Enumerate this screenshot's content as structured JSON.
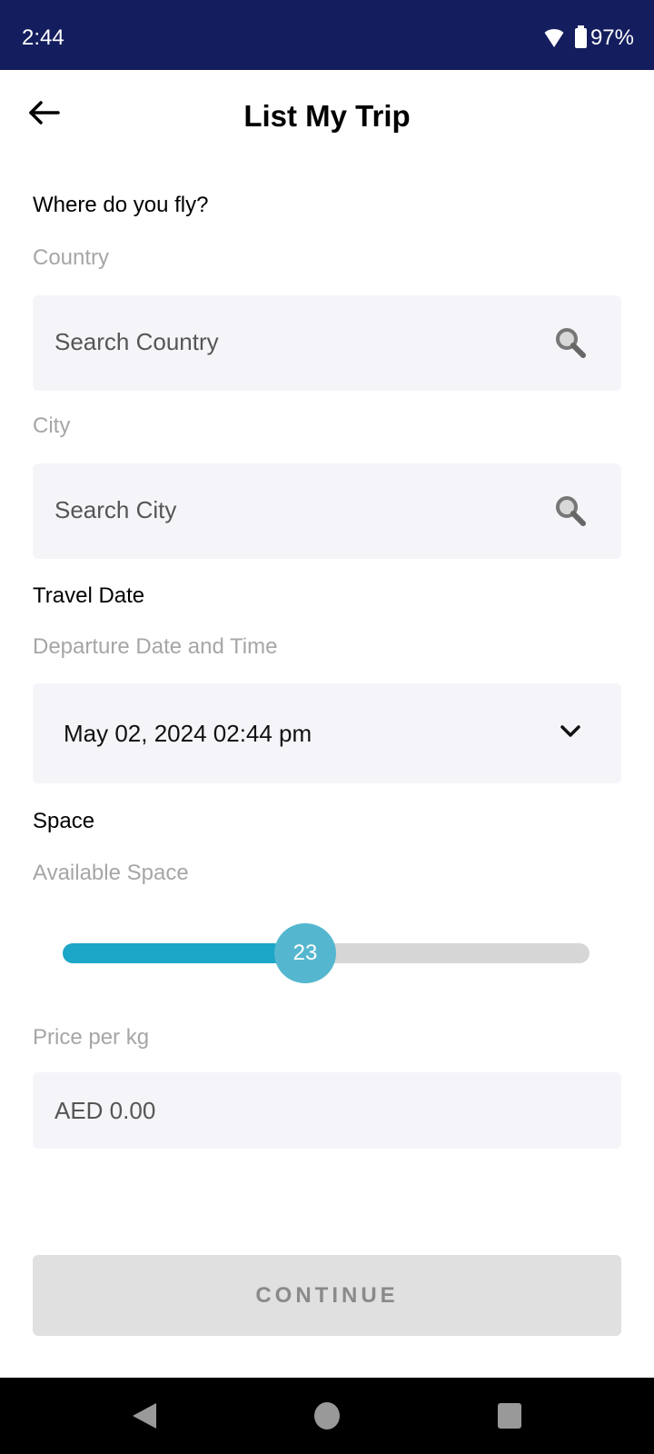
{
  "status_bar": {
    "time": "2:44",
    "battery": "97%"
  },
  "header": {
    "title": "List My Trip"
  },
  "location": {
    "section_title": "Where do you fly?",
    "country_label": "Country",
    "country_placeholder": "Search Country",
    "city_label": "City",
    "city_placeholder": "Search City"
  },
  "travel_date": {
    "section_title": "Travel Date",
    "label": "Departure Date and Time",
    "value": "May 02, 2024 02:44 pm"
  },
  "space": {
    "section_title": "Space",
    "label": "Available Space",
    "slider_value": "23",
    "slider_fraction": 0.47,
    "colors": {
      "fill": "#1ca6c8",
      "thumb": "#55b7cf",
      "track": "#d6d6d6"
    }
  },
  "price": {
    "label": "Price per kg",
    "value": "AED 0.00"
  },
  "actions": {
    "continue_label": "CONTINUE"
  },
  "colors": {
    "status_bar": "#141e5e"
  }
}
